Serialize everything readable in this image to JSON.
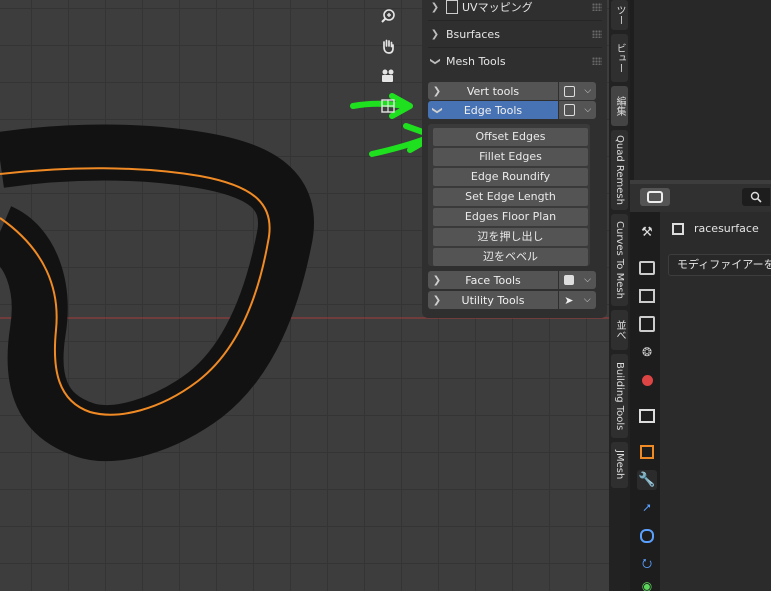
{
  "viewport": {
    "nav_buttons": [
      {
        "name": "zoom-icon"
      },
      {
        "name": "hand-icon"
      },
      {
        "name": "camera-icon"
      },
      {
        "name": "grid-icon"
      }
    ]
  },
  "panels": {
    "uv_mapping": "UVマッピング",
    "bsurfaces": "Bsurfaces",
    "mesh_tools": "Mesh Tools"
  },
  "mesh_tools": {
    "vert_tools": "Vert tools",
    "edge_tools": "Edge Tools",
    "face_tools": "Face Tools",
    "utility_tools": "Utility Tools",
    "edge_sub": [
      "Offset Edges",
      "Fillet Edges",
      "Edge Roundify",
      "Set Edge Length",
      "Edges Floor Plan",
      "辺を押し出し",
      "辺をベベル"
    ]
  },
  "vertical_tabs": [
    "ツー",
    "ビュー",
    "編集",
    "Quad Remesh",
    "Curves To Mesh",
    "並べ",
    "Building Tools",
    "JMesh"
  ],
  "properties": {
    "object_name": "racesurface",
    "modifier_dropdown": "モディファイアーを"
  },
  "colors": {
    "active_tab": "#4772b3",
    "selection_outline": "#f08a24",
    "annotation": "#1fe01f",
    "x_axis": "#a33a3a"
  }
}
